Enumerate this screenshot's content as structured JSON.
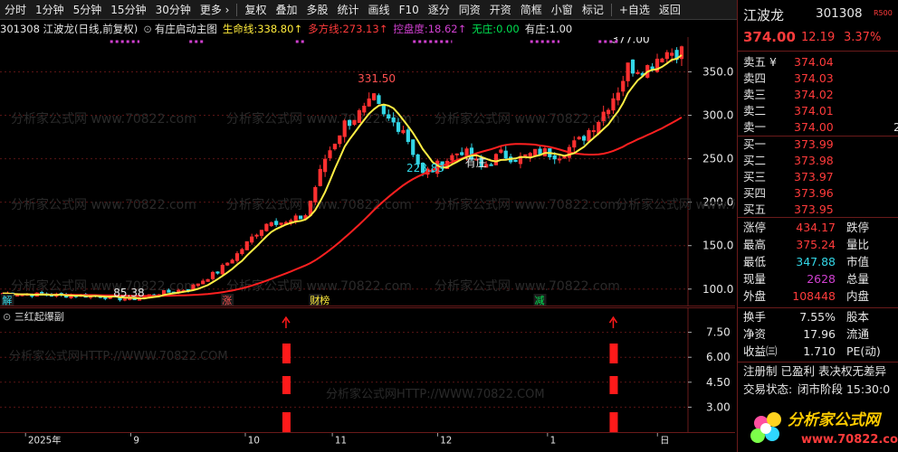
{
  "toolbar": {
    "items": [
      "分时",
      "1分钟",
      "5分钟",
      "15分钟",
      "30分钟",
      "更多 ›",
      "复权",
      "叠加",
      "多股",
      "统计",
      "画线",
      "F10",
      "逐分",
      "同资",
      "开资",
      "简框",
      "小窗",
      "标记",
      "+自选",
      "返回"
    ]
  },
  "info": {
    "stock": "301308 江波龙(日线,前复权)",
    "indicator": "有庄启动主图",
    "items": [
      {
        "label": "生命线:",
        "value": "338.80↑",
        "color": "#ffeb3b"
      },
      {
        "label": "多方线:",
        "value": "273.13↑",
        "color": "#ff3b3b"
      },
      {
        "label": "控盘度:",
        "value": "18.62↑",
        "color": "#d040d0"
      },
      {
        "label": "无庄:",
        "value": "0.00",
        "color": "#00e050"
      },
      {
        "label": "有庄:",
        "value": "1.00",
        "color": "#e6e6e6"
      }
    ]
  },
  "watermarks": [
    "分析家公式网 www.70822.com",
    "分析家公式网HTTP://WWW.70822.COM",
    "分析家公式网HTTP://WWW.70822.COM"
  ],
  "chart_data": [
    {
      "type": "candlestick",
      "title": "301308 江波龙(日线,前复权)",
      "ylim": [
        80,
        390
      ],
      "yticks": [
        100.0,
        150.0,
        200.0,
        250.0,
        300.0,
        350.0
      ],
      "annotations": [
        {
          "text": "331.50",
          "value": 331.5,
          "index": 76,
          "color": "#ff5050"
        },
        {
          "text": "228.83",
          "value": 228.83,
          "index": 86,
          "color": "#33d6e6"
        },
        {
          "text": "85.38",
          "value": 85.38,
          "index": 26,
          "color": "#e6e6e6"
        },
        {
          "text": "377.00",
          "value": 377.0,
          "index": 128,
          "color": "#e6e6e6"
        },
        {
          "text": "有庄",
          "value": 235,
          "index": 98,
          "color": "#e6e6e6"
        }
      ],
      "signals": [
        {
          "text": "解",
          "index": 1,
          "color": "#33d6e6"
        },
        {
          "text": "涨",
          "index": 46,
          "color": "#ff5050"
        },
        {
          "text": "财榜",
          "index": 64,
          "color": "#ffeb3b"
        },
        {
          "text": "减",
          "index": 110,
          "color": "#00e050"
        }
      ],
      "x_labels": [
        {
          "text": "2025年",
          "index": 0
        },
        {
          "text": "9",
          "index": 23
        },
        {
          "text": "10",
          "index": 48
        },
        {
          "text": "11",
          "index": 67
        },
        {
          "text": "12",
          "index": 90
        },
        {
          "text": "1",
          "index": 114
        },
        {
          "text": "日",
          "index": 138
        }
      ]
    },
    {
      "type": "bar",
      "title": "三红起爆副",
      "ylim": [
        1.5,
        9.0
      ],
      "yticks": [
        3.0,
        4.5,
        6.0,
        7.5
      ],
      "signals": [
        {
          "index": 58,
          "value": 8.4
        },
        {
          "index": 125,
          "value": 8.4
        }
      ]
    }
  ],
  "panel": {
    "name": "江波龙",
    "code": "301308",
    "r_badge": "R500",
    "price": "374.00",
    "change": "12.19",
    "pct": "3.37%",
    "asks": [
      {
        "label": "卖五 ¥",
        "price": "374.04"
      },
      {
        "label": "卖四",
        "price": "374.03"
      },
      {
        "label": "卖三",
        "price": "374.02"
      },
      {
        "label": "卖二",
        "price": "374.01"
      },
      {
        "label": "卖一",
        "price": "374.00"
      }
    ],
    "bids": [
      {
        "label": "买一",
        "price": "373.99"
      },
      {
        "label": "买二",
        "price": "373.98"
      },
      {
        "label": "买三",
        "price": "373.97"
      },
      {
        "label": "买四",
        "price": "373.96"
      },
      {
        "label": "买五",
        "price": "373.95"
      }
    ],
    "ask1_extra": "2",
    "stats": [
      {
        "l1": "涨停",
        "v1": "434.17",
        "c1": "red",
        "l2": "跌停"
      },
      {
        "l1": "最高",
        "v1": "375.24",
        "c1": "red",
        "l2": "量比"
      },
      {
        "l1": "最低",
        "v1": "347.88",
        "c1": "cyan",
        "l2": "市值"
      },
      {
        "l1": "现量",
        "v1": "2628",
        "c1": "magenta",
        "l2": "总量"
      },
      {
        "l1": "外盘",
        "v1": "108448",
        "c1": "red",
        "l2": "内盘"
      }
    ],
    "stats2": [
      {
        "l1": "换手",
        "v1": "7.55%",
        "l2": "股本"
      },
      {
        "l1": "净资",
        "v1": "17.96",
        "l2": "流通"
      },
      {
        "l1": "收益㈢",
        "v1": "1.710",
        "l2": "PE(动)"
      }
    ],
    "tags": "注册制 已盈利 表决权无差异",
    "status_label": "交易状态:",
    "status_value": "闭市阶段 15:30:0",
    "logo_text": "分析家公式网",
    "logo_url": "www.70822.com"
  }
}
